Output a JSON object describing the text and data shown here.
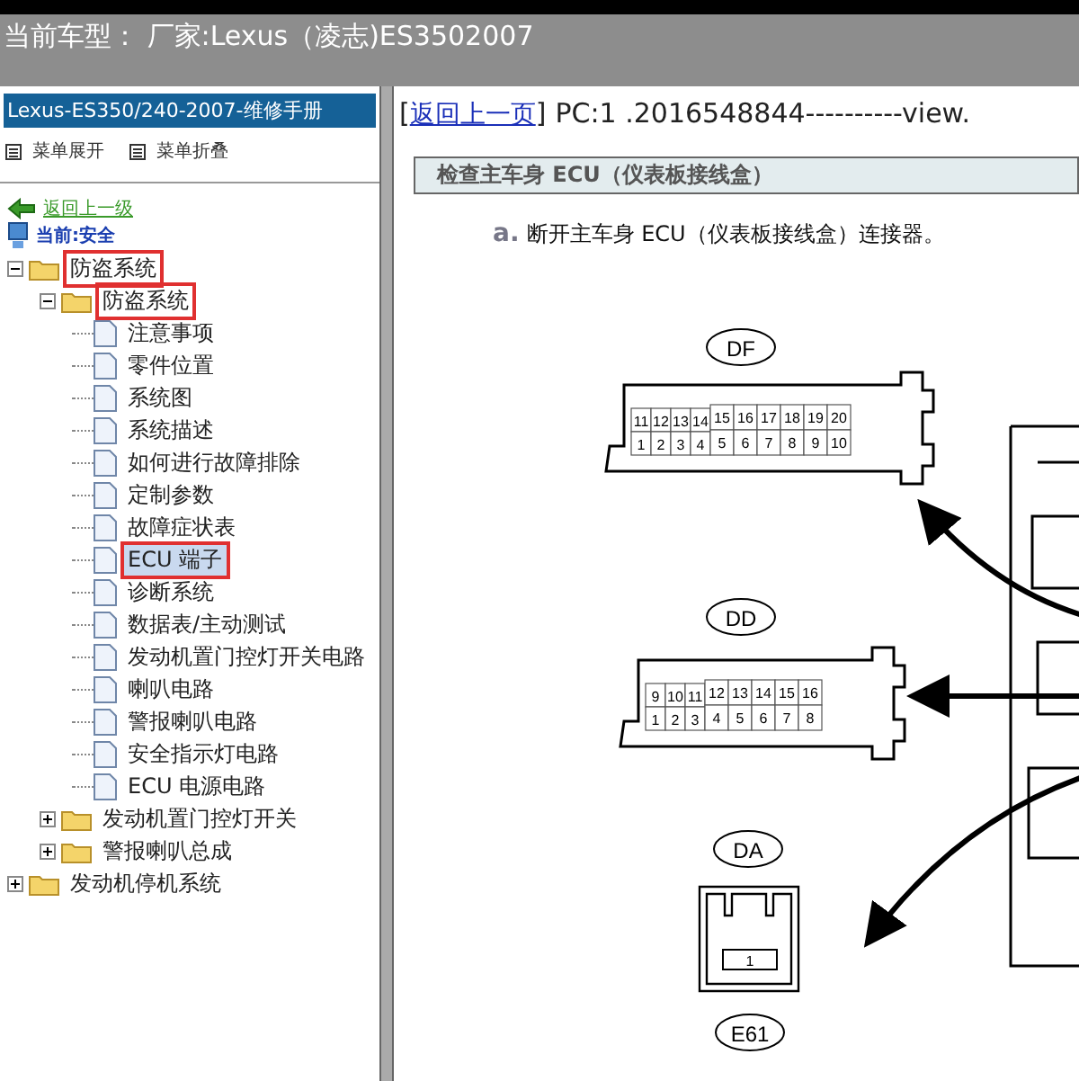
{
  "header": {
    "title": "当前车型： 厂家:Lexus（凌志)ES3502007"
  },
  "sidebar": {
    "title": "Lexus-ES350/240-2007-维修手册",
    "menu_buttons": [
      "菜单展开",
      "菜单折叠"
    ],
    "back_link": "返回上一级",
    "current": "当前:安全",
    "tree": [
      {
        "label": "防盗系统",
        "kind": "folder",
        "expanded": true,
        "selected": false,
        "highlighted": true,
        "children": [
          {
            "label": "防盗系统",
            "kind": "folder",
            "expanded": true,
            "selected": false,
            "highlighted": true,
            "children": [
              {
                "label": "注意事项",
                "kind": "page",
                "selected": false,
                "highlighted": false
              },
              {
                "label": "零件位置",
                "kind": "page",
                "selected": false,
                "highlighted": false
              },
              {
                "label": "系统图",
                "kind": "page",
                "selected": false,
                "highlighted": false
              },
              {
                "label": "系统描述",
                "kind": "page",
                "selected": false,
                "highlighted": false
              },
              {
                "label": "如何进行故障排除",
                "kind": "page",
                "selected": false,
                "highlighted": false
              },
              {
                "label": "定制参数",
                "kind": "page",
                "selected": false,
                "highlighted": false
              },
              {
                "label": "故障症状表",
                "kind": "page",
                "selected": false,
                "highlighted": false
              },
              {
                "label": "ECU 端子",
                "kind": "page",
                "selected": true,
                "highlighted": true
              },
              {
                "label": "诊断系统",
                "kind": "page",
                "selected": false,
                "highlighted": false
              },
              {
                "label": "数据表/主动测试",
                "kind": "page",
                "selected": false,
                "highlighted": false
              },
              {
                "label": "发动机置门控灯开关电路",
                "kind": "page",
                "selected": false,
                "highlighted": false
              },
              {
                "label": "喇叭电路",
                "kind": "page",
                "selected": false,
                "highlighted": false
              },
              {
                "label": "警报喇叭电路",
                "kind": "page",
                "selected": false,
                "highlighted": false
              },
              {
                "label": "安全指示灯电路",
                "kind": "page",
                "selected": false,
                "highlighted": false
              },
              {
                "label": "ECU 电源电路",
                "kind": "page",
                "selected": false,
                "highlighted": false
              }
            ]
          },
          {
            "label": "发动机置门控灯开关",
            "kind": "folder",
            "expanded": false,
            "selected": false,
            "highlighted": false
          },
          {
            "label": "警报喇叭总成",
            "kind": "folder",
            "expanded": false,
            "selected": false,
            "highlighted": false
          }
        ]
      },
      {
        "label": "发动机停机系统",
        "kind": "folder",
        "expanded": false,
        "selected": false,
        "highlighted": false
      }
    ]
  },
  "content": {
    "open_bracket": "[",
    "back_link": "返回上一页",
    "close_bracket": "]",
    "page_info": "PC:1 .2016548844----------view.",
    "section_title": "检查主车身 ECU（仪表板接线盒）",
    "step_marker": "a.",
    "step_text": "断开主车身 ECU（仪表板接线盒）连接器。",
    "connectors": [
      {
        "label": "DF",
        "kind": "wide",
        "small_top_pins": [
          "11",
          "12",
          "13",
          "14"
        ],
        "small_bottom_pins": [
          "1",
          "2",
          "3",
          "4"
        ],
        "large_top_pins": [
          "15",
          "16",
          "17",
          "18",
          "19",
          "20"
        ],
        "large_bottom_pins": [
          "5",
          "6",
          "7",
          "8",
          "9",
          "10"
        ]
      },
      {
        "label": "DD",
        "kind": "wide",
        "small_top_pins": [
          "9",
          "10",
          "11"
        ],
        "small_bottom_pins": [
          "1",
          "2",
          "3"
        ],
        "large_top_pins": [
          "12",
          "13",
          "14",
          "15",
          "16"
        ],
        "large_bottom_pins": [
          "4",
          "5",
          "6",
          "7",
          "8"
        ]
      },
      {
        "label": "DA",
        "kind": "single",
        "pin": "1"
      },
      {
        "label": "E61",
        "kind": "label_only"
      }
    ]
  }
}
